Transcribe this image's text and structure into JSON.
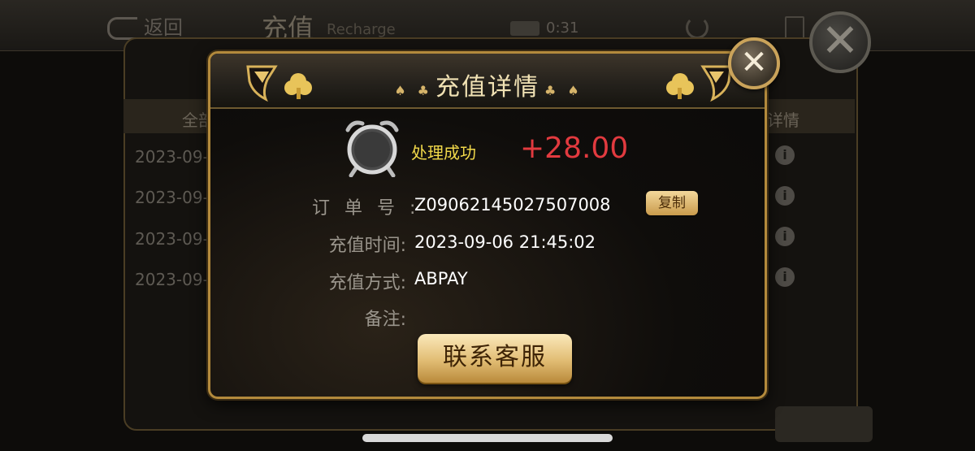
{
  "background": {
    "nav": {
      "back_label": "返回",
      "title": "充值",
      "title_en": "Recharge",
      "timer": "0:31"
    },
    "table": {
      "headers": [
        "全部",
        "详情"
      ],
      "rows": [
        "2023-09-",
        "2023-09-",
        "2023-09-",
        "2023-09-"
      ]
    },
    "info_glyph": "i"
  },
  "modal": {
    "title": "充值详情",
    "suits": {
      "spade": "♠",
      "club": "♣"
    },
    "status": "处理成功",
    "amount": "+28.00",
    "fields": {
      "order_label": "订单号:",
      "order_value": "Z09062145027507008",
      "copy_label": "复制",
      "time_label": "充值时间:",
      "time_value": "2023-09-06 21:45:02",
      "method_label": "充值方式:",
      "method_value": "ABPAY",
      "note_label": "备注:",
      "note_value": ""
    },
    "contact_button": "联系客服",
    "close_glyph": "✕"
  },
  "colors": {
    "status": "#f2d94a",
    "amount": "#e23a3f",
    "gold_border": "#b38a3c"
  },
  "icons": [
    "alarm-clock-icon",
    "close-icon",
    "info-icon",
    "spade-icon",
    "club-icon"
  ]
}
